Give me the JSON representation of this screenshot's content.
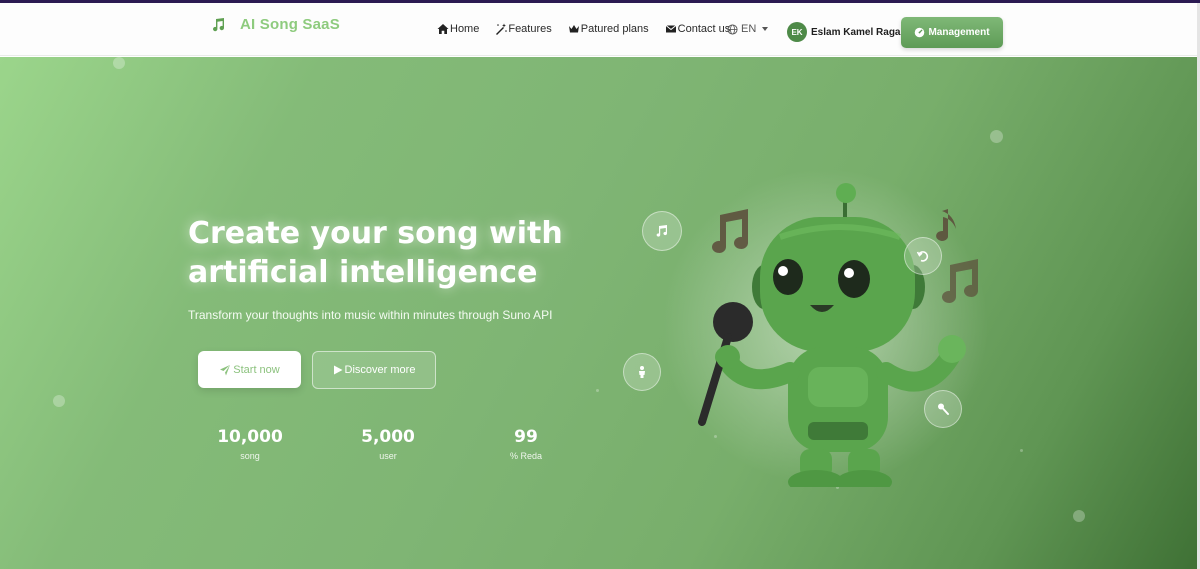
{
  "brand": {
    "name": "AI Song SaaS",
    "icon": "music-note-icon"
  },
  "nav": {
    "items": [
      {
        "label": "Home",
        "icon": "home-icon"
      },
      {
        "label": "Features",
        "icon": "magic-wand-icon"
      },
      {
        "label": "Patured plans",
        "icon": "crown-icon"
      },
      {
        "label": "Contact us",
        "icon": "envelope-icon"
      }
    ],
    "language": "EN"
  },
  "user": {
    "initials": "EK",
    "name": "Eslam Kamel Ragab"
  },
  "management_button": "Management",
  "hero": {
    "title_line1": "Create your song with",
    "title_line2": "artificial intelligence",
    "subtitle": "Transform your thoughts into music within minutes through Suno API",
    "start_button": "Start now",
    "discover_button": "Discover more"
  },
  "stats": [
    {
      "value": "10,000",
      "label": "song"
    },
    {
      "value": "5,000",
      "label": "user"
    },
    {
      "value": "99",
      "label": "% Reda"
    }
  ],
  "colors": {
    "accent": "#8ecb7e",
    "hero_start": "#9bd58b",
    "hero_end": "#3f7135",
    "robot": "#5aa54d"
  },
  "floating_icons": [
    "music-note-icon",
    "rotate-icon",
    "person-icon",
    "microphone-icon"
  ]
}
